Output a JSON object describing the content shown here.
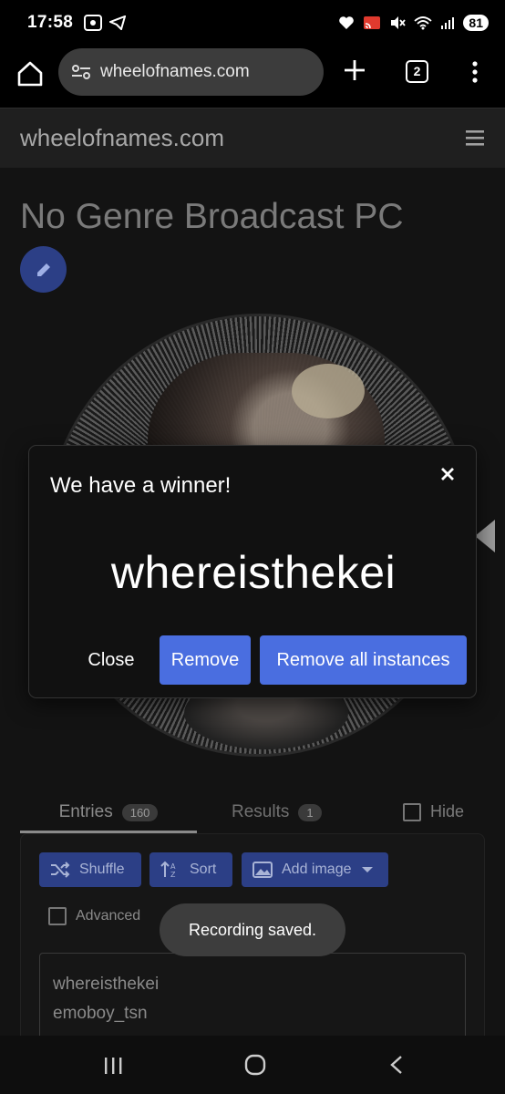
{
  "status_bar": {
    "time": "17:58",
    "battery": "81"
  },
  "browser": {
    "url": "wheelofnames.com",
    "tab_count": "2"
  },
  "site": {
    "title": "wheelofnames.com"
  },
  "page": {
    "title": "No Genre Broadcast PC"
  },
  "tabs": {
    "entries_label": "Entries",
    "entries_count": "160",
    "results_label": "Results",
    "results_count": "1",
    "hide_label": "Hide"
  },
  "toolbar": {
    "shuffle_label": "Shuffle",
    "sort_label": "Sort",
    "add_image_label": "Add image",
    "advanced_label": "Advanced"
  },
  "entries": [
    "whereisthekei",
    "emoboy_tsn"
  ],
  "toast": {
    "message": "Recording saved."
  },
  "dialog": {
    "title": "We have a winner!",
    "winner": "whereisthekei",
    "close_label": "Close",
    "remove_label": "Remove",
    "remove_all_label": "Remove all instances"
  },
  "colors": {
    "accent": "#4a6ee0",
    "accent_dim": "#2c3f86"
  }
}
